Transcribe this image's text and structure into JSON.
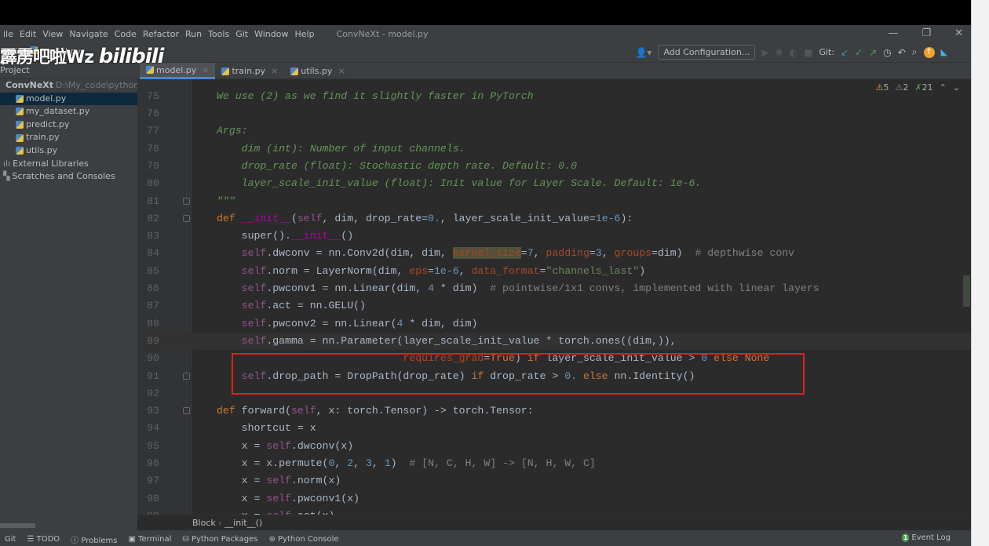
{
  "window": {
    "title": "ConvNeXt - model.py"
  },
  "menu": [
    "ile",
    "Edit",
    "View",
    "Navigate",
    "Code",
    "Refactor",
    "Run",
    "Tools",
    "Git",
    "Window",
    "Help"
  ],
  "breadcrumb_top": [
    "NeXt",
    "model.py"
  ],
  "watermark": "霹雳吧啦Wz bilibili",
  "toolbar": {
    "add_configuration": "Add Configuration...",
    "git_label": "Git:"
  },
  "project": {
    "header": "Project",
    "items": [
      {
        "label": "ConvNeXt",
        "path": "D:\\My_code\\pythonP",
        "type": "folder"
      },
      {
        "label": "model.py",
        "type": "py",
        "selected": true
      },
      {
        "label": "my_dataset.py",
        "type": "py"
      },
      {
        "label": "predict.py",
        "type": "py"
      },
      {
        "label": "train.py",
        "type": "py"
      },
      {
        "label": "utils.py",
        "type": "py"
      },
      {
        "label": "External Libraries",
        "type": "lib"
      },
      {
        "label": "Scratches and Consoles",
        "type": "scratch"
      }
    ]
  },
  "tabs": [
    {
      "label": "model.py",
      "active": true
    },
    {
      "label": "train.py"
    },
    {
      "label": "utils.py"
    }
  ],
  "inspections": {
    "warnings": "5",
    "weak_warnings": "2",
    "typos": "21"
  },
  "code": [
    {
      "n": "75",
      "t": [
        [
          "We use (2) as we find it slightly faster in PyTorch",
          "cm"
        ]
      ]
    },
    {
      "n": "76",
      "t": []
    },
    {
      "n": "77",
      "t": [
        [
          "Args:",
          "cm"
        ]
      ]
    },
    {
      "n": "78",
      "t": [
        [
          "    dim (int): Number of input channels.",
          "cm"
        ]
      ]
    },
    {
      "n": "79",
      "t": [
        [
          "    drop_rate (float): Stochastic depth rate. Default: 0.0",
          "cm"
        ]
      ]
    },
    {
      "n": "80",
      "t": [
        [
          "    layer_scale_init_value (float): Init value for Layer Scale. Default: 1e-6.",
          "cm"
        ]
      ]
    },
    {
      "n": "81",
      "t": [
        [
          "\"\"\"",
          "cm"
        ]
      ],
      "fold": true
    },
    {
      "n": "82",
      "t": [
        [
          "def ",
          "kw"
        ],
        [
          "__init__",
          "mag"
        ],
        [
          "(",
          ""
        ],
        [
          "self",
          "self"
        ],
        [
          ", dim, drop_rate=",
          ""
        ],
        [
          "0.",
          "num"
        ],
        [
          ", layer_scale_init_value=",
          ""
        ],
        [
          "1e-6",
          "num"
        ],
        [
          "):",
          ""
        ]
      ],
      "fold": true
    },
    {
      "n": "83",
      "t": [
        [
          "    super().",
          ""
        ],
        [
          "__init__",
          "mag"
        ],
        [
          "()",
          ""
        ]
      ]
    },
    {
      "n": "84",
      "t": [
        [
          "    ",
          ""
        ],
        [
          "self",
          "self"
        ],
        [
          ".dwconv = nn.Conv2d(dim, dim, ",
          ""
        ],
        [
          "kernel_size",
          "hl"
        ],
        [
          "=",
          ""
        ],
        [
          "7",
          "num"
        ],
        [
          ", ",
          ""
        ],
        [
          "padding",
          "kwa"
        ],
        [
          "=",
          ""
        ],
        [
          "3",
          "num"
        ],
        [
          ", ",
          ""
        ],
        [
          "groups",
          "kwa"
        ],
        [
          "=dim)  ",
          ""
        ],
        [
          "# depthwise conv",
          "lc"
        ]
      ]
    },
    {
      "n": "85",
      "t": [
        [
          "    ",
          ""
        ],
        [
          "self",
          "self"
        ],
        [
          ".norm = LayerNorm(dim, ",
          ""
        ],
        [
          "eps",
          "kwa"
        ],
        [
          "=",
          ""
        ],
        [
          "1e-6",
          "num"
        ],
        [
          ", ",
          ""
        ],
        [
          "data_format",
          "kwa"
        ],
        [
          "=",
          ""
        ],
        [
          "\"channels_last\"",
          "str"
        ],
        [
          ")",
          ""
        ]
      ]
    },
    {
      "n": "86",
      "t": [
        [
          "    ",
          ""
        ],
        [
          "self",
          "self"
        ],
        [
          ".pwconv1 = nn.Linear(dim, ",
          ""
        ],
        [
          "4",
          "num"
        ],
        [
          " * dim)  ",
          ""
        ],
        [
          "# pointwise/1x1 convs, implemented with linear layers",
          "lc"
        ]
      ]
    },
    {
      "n": "87",
      "t": [
        [
          "    ",
          ""
        ],
        [
          "self",
          "self"
        ],
        [
          ".act = nn.GELU()",
          ""
        ]
      ]
    },
    {
      "n": "88",
      "t": [
        [
          "    ",
          ""
        ],
        [
          "self",
          "self"
        ],
        [
          ".pwconv2 = nn.Linear(",
          ""
        ],
        [
          "4",
          "num"
        ],
        [
          " * dim, dim)",
          ""
        ]
      ]
    },
    {
      "n": "89",
      "t": [
        [
          "    ",
          ""
        ],
        [
          "self",
          "self"
        ],
        [
          ".gamma = nn.Parameter(layer_scale_init_value * torch.ones((dim,)),",
          ""
        ]
      ],
      "current": true
    },
    {
      "n": "90",
      "t": [
        [
          "                              ",
          ""
        ],
        [
          "requires_grad",
          "kwa"
        ],
        [
          "=",
          ""
        ],
        [
          "True",
          "kw"
        ],
        [
          ") ",
          ""
        ],
        [
          "if ",
          "kw"
        ],
        [
          "layer_scale_init_value > ",
          ""
        ],
        [
          "0 ",
          "num"
        ],
        [
          "else None",
          "kw"
        ]
      ]
    },
    {
      "n": "91",
      "t": [
        [
          "    ",
          ""
        ],
        [
          "self",
          "self"
        ],
        [
          ".drop_path = DropPath(drop_rate) ",
          ""
        ],
        [
          "if ",
          "kw"
        ],
        [
          "drop_rate > ",
          ""
        ],
        [
          "0. ",
          "num"
        ],
        [
          "else ",
          "kw"
        ],
        [
          "nn.Identity()",
          ""
        ]
      ],
      "fold": true
    },
    {
      "n": "92",
      "t": []
    },
    {
      "n": "93",
      "t": [
        [
          "def ",
          "kw"
        ],
        [
          "forward",
          ""
        ],
        [
          "(",
          ""
        ],
        [
          "self",
          "self"
        ],
        [
          ", x: torch.Tensor) -> torch.Tensor:",
          ""
        ]
      ],
      "fold": true
    },
    {
      "n": "94",
      "t": [
        [
          "    shortcut = x",
          ""
        ]
      ]
    },
    {
      "n": "95",
      "t": [
        [
          "    x = ",
          ""
        ],
        [
          "self",
          "self"
        ],
        [
          ".dwconv(x)",
          ""
        ]
      ]
    },
    {
      "n": "96",
      "t": [
        [
          "    x = x.permute(",
          ""
        ],
        [
          "0",
          "num"
        ],
        [
          ", ",
          ""
        ],
        [
          "2",
          "num"
        ],
        [
          ", ",
          ""
        ],
        [
          "3",
          "num"
        ],
        [
          ", ",
          ""
        ],
        [
          "1",
          "num"
        ],
        [
          ")  ",
          ""
        ],
        [
          "# [N, C, H, W] -> [N, H, W, C]",
          "lc"
        ]
      ]
    },
    {
      "n": "97",
      "t": [
        [
          "    x = ",
          ""
        ],
        [
          "self",
          "self"
        ],
        [
          ".norm(x)",
          ""
        ]
      ]
    },
    {
      "n": "98",
      "t": [
        [
          "    x = ",
          ""
        ],
        [
          "self",
          "self"
        ],
        [
          ".pwconv1(x)",
          ""
        ]
      ]
    },
    {
      "n": "99",
      "t": [
        [
          "    x = ",
          ""
        ],
        [
          "self",
          "self"
        ],
        [
          ".act(x)",
          ""
        ]
      ]
    }
  ],
  "code_breadcrumb": [
    "Block",
    "__init__()"
  ],
  "statusbar": {
    "items": [
      "Git",
      "TODO",
      "Problems",
      "Terminal",
      "Python Packages",
      "Python Console"
    ],
    "event_log": "Event Log",
    "event_count": "1"
  },
  "colors": {
    "accent": "#4a88c7",
    "highlight_box": "#e02020",
    "editor_bg": "#2b2b2b"
  }
}
